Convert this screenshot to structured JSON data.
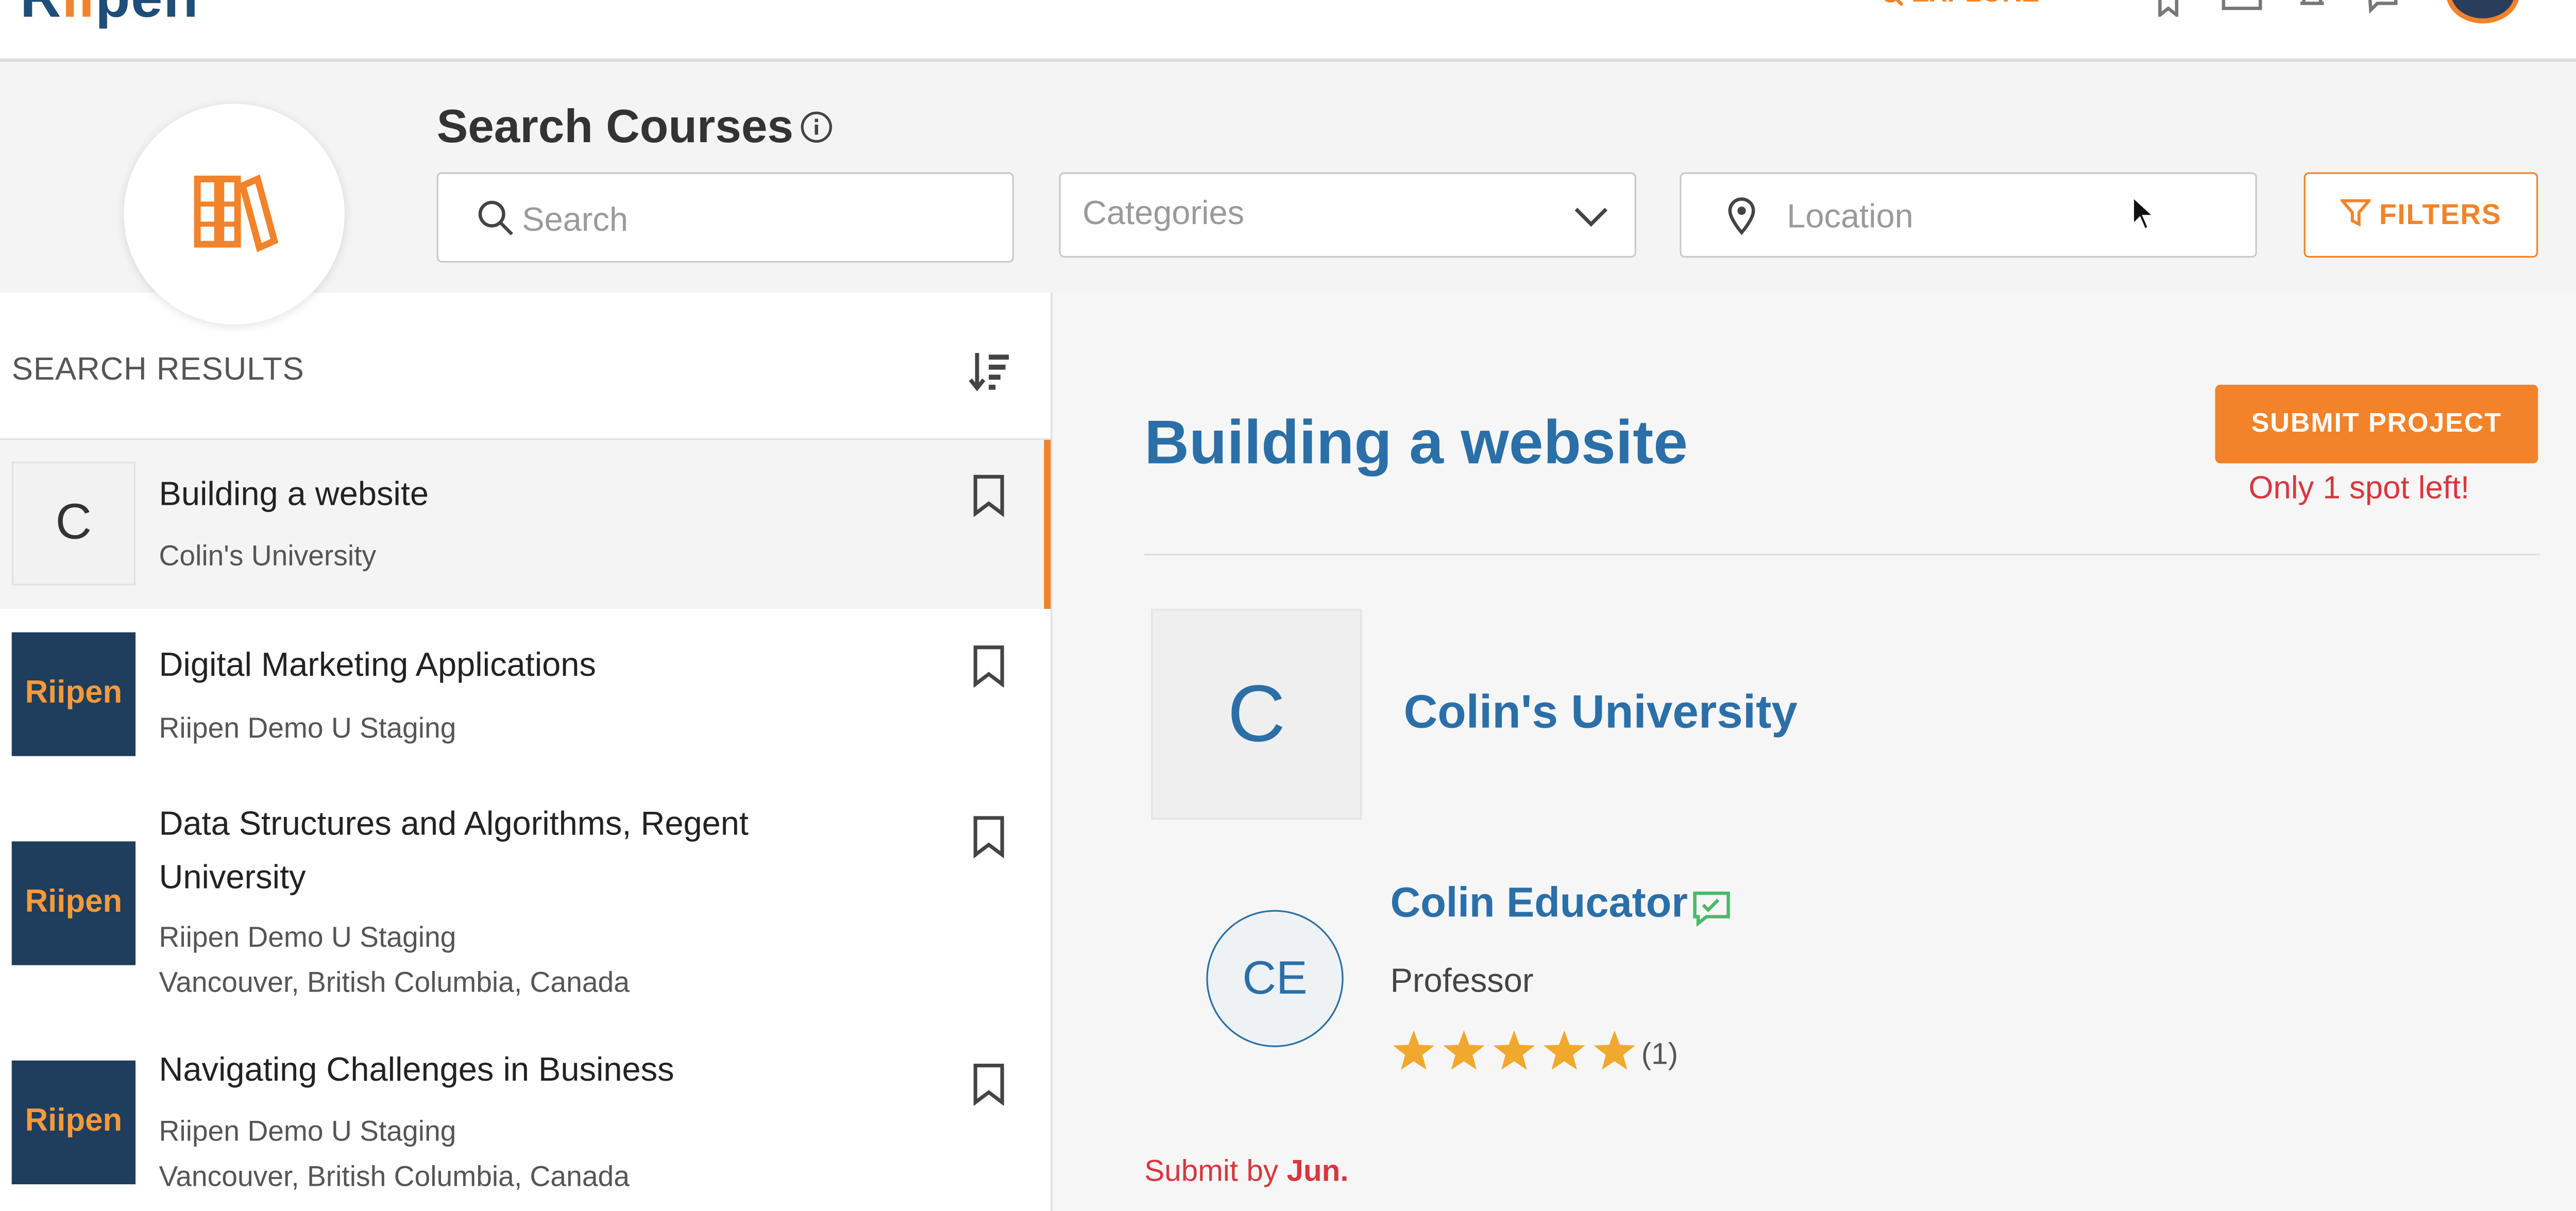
{
  "topbar": {
    "logo_text": "Riipen",
    "explore_label": "EXPLORE",
    "icons": [
      "bookmark-icon",
      "inbox-icon",
      "bell-icon",
      "chat-icon"
    ]
  },
  "search": {
    "title": "Search Courses",
    "search_placeholder": "Search",
    "categories_placeholder": "Categories",
    "location_placeholder": "Location",
    "filters_label": "FILTERS"
  },
  "results": {
    "heading": "SEARCH RESULTS",
    "items": [
      {
        "thumb": "C",
        "title": "Building a website",
        "subtitle": "Colin's University",
        "location": ""
      },
      {
        "thumb": "Riipen",
        "title": "Digital Marketing Applications",
        "subtitle": "Riipen Demo U Staging",
        "location": ""
      },
      {
        "thumb": "Riipen",
        "title": "Data Structures and Algorithms, Regent University",
        "subtitle": "Riipen Demo U Staging",
        "location": "Vancouver, British Columbia, Canada"
      },
      {
        "thumb": "Riipen",
        "title": "Navigating Challenges in Business",
        "subtitle": "Riipen Demo U Staging",
        "location": "Vancouver, British Columbia, Canada"
      }
    ]
  },
  "detail": {
    "title": "Building a website",
    "submit_label": "SUBMIT PROJECT",
    "spots_text": "Only 1 spot left!",
    "org_initial": "C",
    "org_name": "Colin's University",
    "person_initials": "CE",
    "person_name": "Colin Educator",
    "person_role": "Professor",
    "rating_stars": 5,
    "review_count": "(1)",
    "submit_by_prefix": "Submit by",
    "submit_by_date": "Jun."
  },
  "colors": {
    "accent": "#f2832a",
    "link_blue": "#2b6fa8",
    "alert_red": "#d9363e",
    "navy": "#1f3d5c"
  }
}
